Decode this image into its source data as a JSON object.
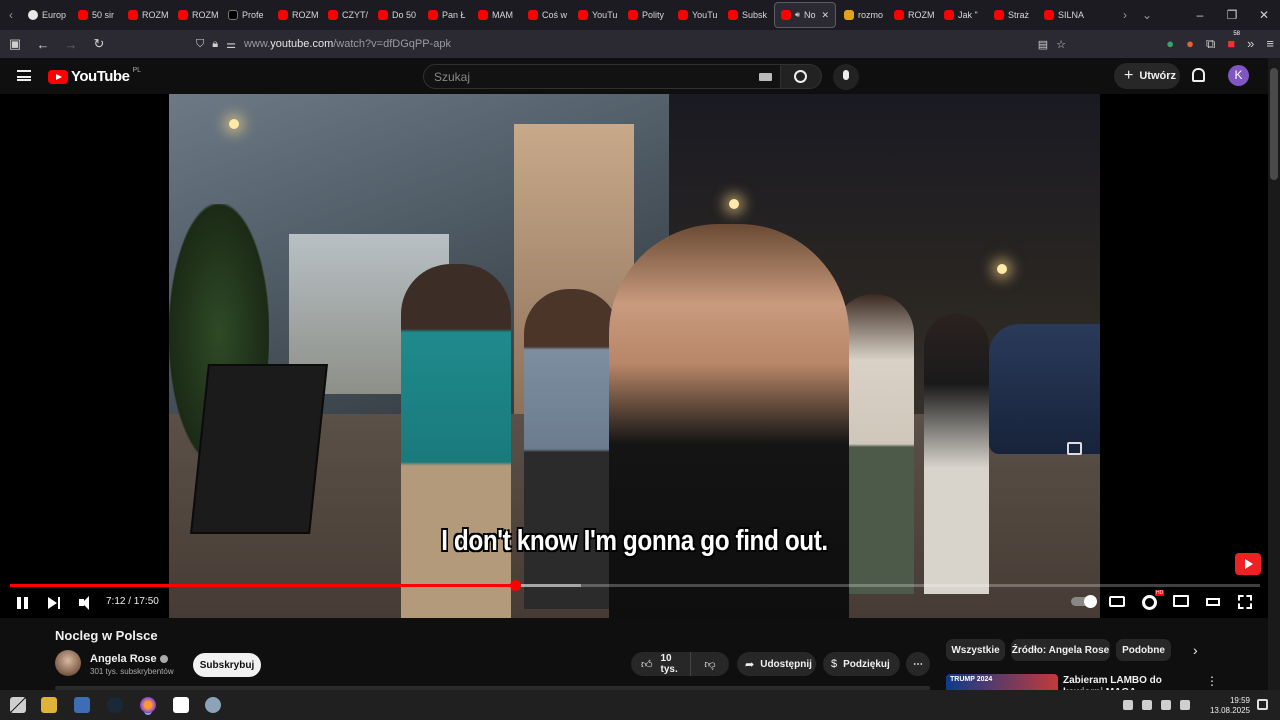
{
  "browser": {
    "tabs": [
      {
        "label": "Europ",
        "icon": "opera-icon"
      },
      {
        "label": "50 sir",
        "icon": "youtube-icon"
      },
      {
        "label": "ROZM",
        "icon": "youtube-icon"
      },
      {
        "label": "ROZM",
        "icon": "youtube-icon"
      },
      {
        "label": "Profe",
        "icon": "x-icon"
      },
      {
        "label": "ROZM",
        "icon": "youtube-icon"
      },
      {
        "label": "CZYT/",
        "icon": "youtube-icon"
      },
      {
        "label": "Do 50",
        "icon": "youtube-icon"
      },
      {
        "label": "Pan Ł",
        "icon": "youtube-icon"
      },
      {
        "label": "MAM",
        "icon": "youtube-icon"
      },
      {
        "label": "Coś w",
        "icon": "youtube-icon"
      },
      {
        "label": "YouTu",
        "icon": "youtube-icon"
      },
      {
        "label": "Polity",
        "icon": "youtube-icon"
      },
      {
        "label": "YouTu",
        "icon": "youtube-icon"
      },
      {
        "label": "Subsk",
        "icon": "youtube-icon"
      },
      {
        "label": "No",
        "icon": "youtube-icon",
        "active": true
      },
      {
        "label": "rozmo",
        "icon": "jp-icon"
      },
      {
        "label": "ROZM",
        "icon": "youtube-icon"
      },
      {
        "label": "Jak \"",
        "icon": "youtube-icon"
      },
      {
        "label": "Straż",
        "icon": "youtube-icon"
      },
      {
        "label": "SILNA",
        "icon": "youtube-icon"
      }
    ],
    "url_prefix": "www.",
    "url_domain": "youtube.com",
    "url_path": "/watch?v=dfDGqPP-apk",
    "extension_badge": "58"
  },
  "youtube": {
    "logo_text": "YouTube",
    "region": "PL",
    "search_placeholder": "Szukaj",
    "create_label": "Utwórz",
    "avatar_letter": "K",
    "player": {
      "subtitle": "I don't know I'm gonna go find out.",
      "current_time": "7:12",
      "duration": "17:50",
      "time_display": "7:12 / 17:50",
      "progress_fraction": 0.404,
      "buffer_fraction": 0.457,
      "settings_badge": "HD"
    },
    "video": {
      "title": "Nocleg w Polsce",
      "channel": "Angela Rose",
      "subscribers": "301 tys. subskrybentów",
      "subscribe_label": "Subskrybuj",
      "likes": "10 tys.",
      "share_label": "Udostępnij",
      "thanks_label": "Podziękuj",
      "more_label": "⋯"
    },
    "chips": [
      {
        "label": "Wszystkie",
        "active": true
      },
      {
        "label": "Źródło: Angela Rose",
        "active": false
      },
      {
        "label": "Podobne",
        "active": false
      }
    ],
    "recommendation": {
      "title": "Zabieram LAMBO do kawiarni MAGA",
      "thumb_text": "TRUMP 2024"
    }
  },
  "taskbar": {
    "time": "19:59",
    "date": "13.08.2025"
  }
}
